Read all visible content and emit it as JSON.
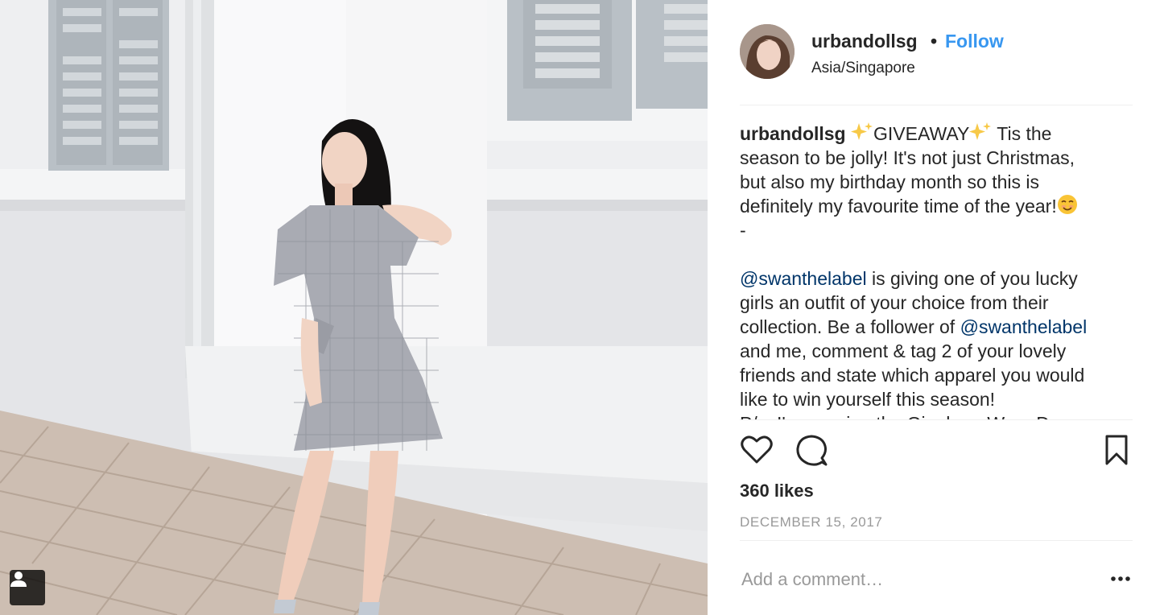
{
  "post": {
    "username": "urbandollsg",
    "separator": "•",
    "follow_label": "Follow",
    "location": "Asia/Singapore",
    "caption": {
      "user": "urbandollsg",
      "giveaway": "GIVEAWAY",
      "line1_tail": " Tis the",
      "line2": "season to be jolly! It's not just Christmas,",
      "line3": "but also my birthday month so this is",
      "line4": "definitely my favourite time of the year!",
      "line5": "-",
      "mention1": "@swanthelabel",
      "line7_tail": " is giving one of you lucky",
      "line8": "girls an outfit of your choice from their",
      "line9_head": "collection. Be a follower of ",
      "mention2": "@swanthelabel",
      "line10": "and me, comment & tag 2 of your lovely",
      "line11": "friends and state which apparel you would",
      "line12": "like to win yourself this season!",
      "line13": "P/s: I'm wearing the Gingham Wrap Dress"
    },
    "likes": "360 likes",
    "date": "DECEMBER 15, 2017",
    "comment_placeholder": "Add a comment…"
  },
  "icons": {
    "like": "heart-icon",
    "comment": "comment-icon",
    "save": "bookmark-icon",
    "more": "more-options-icon",
    "tag": "user-tag-icon",
    "sparkles": "sparkles-emoji",
    "smile": "smiling-face-emoji"
  },
  "colors": {
    "link": "#3897f0",
    "mention": "#003569",
    "muted": "#999999",
    "text": "#262626"
  }
}
